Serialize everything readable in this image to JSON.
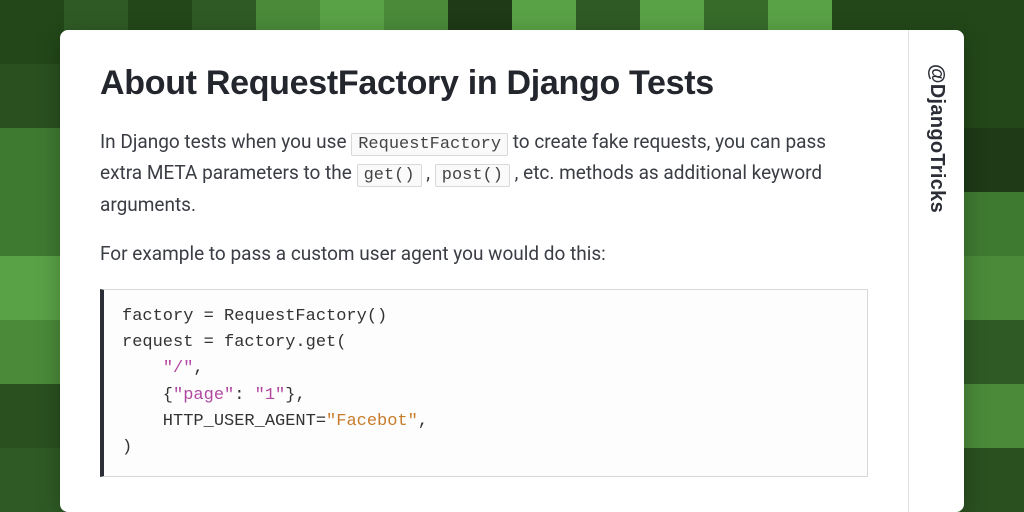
{
  "bg": {
    "palette": [
      "#1e3a16",
      "#2a5020",
      "#366b2a",
      "#3f7a31",
      "#4a8a39",
      "#5aa246",
      "#2f5a25",
      "#234719"
    ]
  },
  "handle": "@DjangoTricks",
  "title": "About RequestFactory in Django Tests",
  "para1_parts": [
    "In Django tests when you use ",
    "RequestFactory",
    " to create fake requests, you can pass extra META parameters to the ",
    "get()",
    " , ",
    "post()",
    " , etc. methods as additional keyword arguments."
  ],
  "para2": "For example to pass a custom user agent you would do this:",
  "code": {
    "l1": "factory = RequestFactory()",
    "l2": "request = factory.get(",
    "l3_indent": "    ",
    "l3_str": "\"/\"",
    "l3_tail": ",",
    "l4_indent": "    {",
    "l4_k": "\"page\"",
    "l4_sep": ": ",
    "l4_v": "\"1\"",
    "l4_tail": "},",
    "l5_indent": "    HTTP_USER_AGENT=",
    "l5_str": "\"Facebot\"",
    "l5_tail": ",",
    "l6": ")"
  }
}
